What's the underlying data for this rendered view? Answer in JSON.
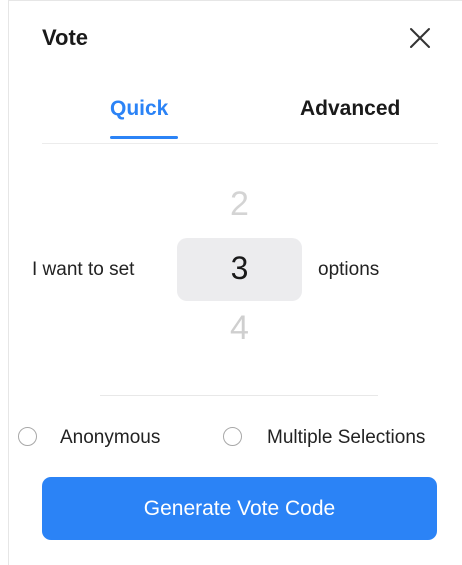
{
  "header": {
    "title": "Vote",
    "close_icon": "close-icon"
  },
  "tabs": [
    {
      "label": "Quick",
      "active": true
    },
    {
      "label": "Advanced",
      "active": false
    }
  ],
  "picker": {
    "prefix": "I want to set",
    "suffix": "options",
    "previous": "2",
    "current": "3",
    "next": "4"
  },
  "options": [
    {
      "label": "Anonymous",
      "checked": false
    },
    {
      "label": "Multiple Selections",
      "checked": false
    }
  ],
  "generate_button": {
    "label": "Generate Vote Code"
  },
  "colors": {
    "accent": "#2b83f6",
    "text": "#1a1a1a",
    "picker_bg": "#ececee"
  }
}
